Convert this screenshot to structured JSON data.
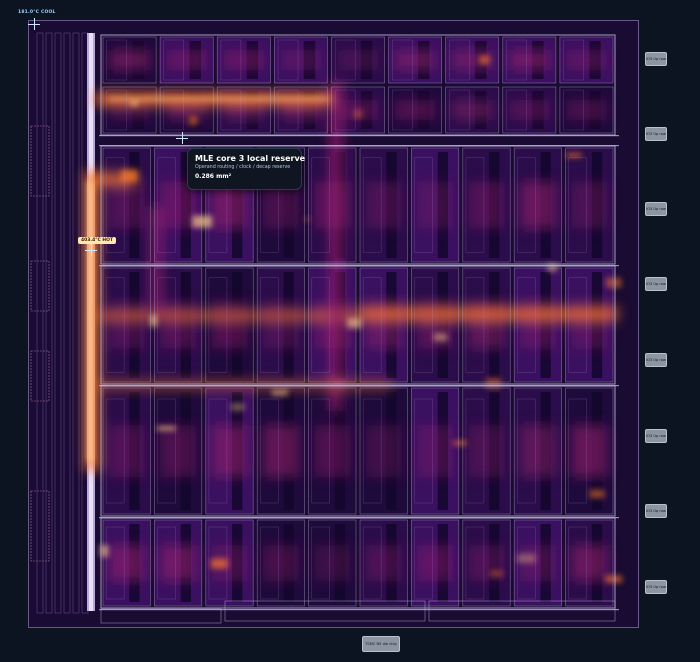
{
  "markers": {
    "cool": "181.0°C COOL",
    "hot": "403.4°C HOT"
  },
  "tooltip": {
    "title": "MLE core 3 local reserve",
    "subtitle": "Operand routing / clock / decap reserve",
    "area": "0.286 mm²"
  },
  "io_ports": [
    "IO3 Up rawl",
    "IO3 Up rawl",
    "IO3 Up rawl",
    "IO3 Up rawl",
    "IO3 Up rawl",
    "IO3 Up rawl",
    "IO3 Up rawl",
    "IO3 Up rawl"
  ],
  "die_size_chip": "TSMC N5 die chip",
  "colors": {
    "background": "#0b1420",
    "die_base": "#1a0b33",
    "heat_low": "#2a0d4a",
    "heat_mid": "#9a1e6e",
    "heat_high": "#ff7a2a",
    "heat_peak": "#ffd08a",
    "outline": "#c8b8e8"
  },
  "icons": {
    "crosshair": "crosshair-icon"
  }
}
